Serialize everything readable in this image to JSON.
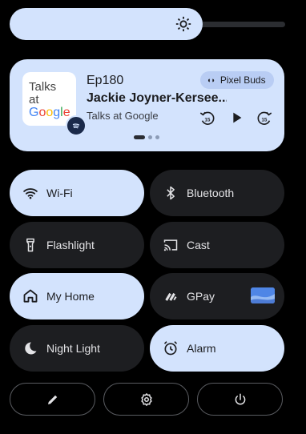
{
  "brightness": {
    "level": 0.7,
    "icon": "brightness-icon"
  },
  "media": {
    "album_art": {
      "line1": "Talks",
      "line2": "at",
      "line3": "Google"
    },
    "episode": "Ep180",
    "title": "Jackie Joyner-Kersee...",
    "artist": "Talks at Google",
    "device": "Pixel Buds",
    "source_icon": "spotify-icon",
    "page_index": 0,
    "page_count": 3
  },
  "tiles": [
    {
      "label": "Wi-Fi",
      "icon": "wifi-icon",
      "state": "on"
    },
    {
      "label": "Bluetooth",
      "icon": "bluetooth-icon",
      "state": "off"
    },
    {
      "label": "Flashlight",
      "icon": "flashlight-icon",
      "state": "off"
    },
    {
      "label": "Cast",
      "icon": "cast-icon",
      "state": "off"
    },
    {
      "label": "My Home",
      "icon": "home-icon",
      "state": "on"
    },
    {
      "label": "GPay",
      "icon": "gpay-icon",
      "state": "off"
    },
    {
      "label": "Night Light",
      "icon": "moon-icon",
      "state": "off"
    },
    {
      "label": "Alarm",
      "icon": "alarm-icon",
      "state": "on"
    }
  ],
  "bottom_buttons": [
    {
      "icon": "edit-icon"
    },
    {
      "icon": "settings-icon"
    },
    {
      "icon": "power-icon"
    }
  ],
  "colors": {
    "background": "#000000",
    "tile_on": "#d3e3fd",
    "tile_off": "#1d1e21",
    "text_dark": "#1c1d20",
    "text_light": "#e3e3e6"
  }
}
